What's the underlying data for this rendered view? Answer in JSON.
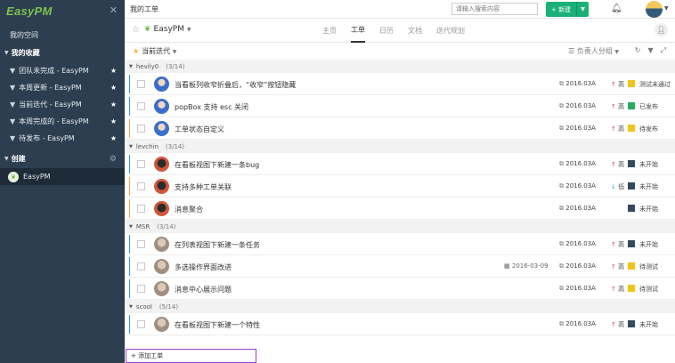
{
  "sidebar": {
    "logo": "EasyPM",
    "my_space": "我的空间",
    "favorites_header": "我的收藏",
    "favorites": [
      "团队未完成 - EasyPM",
      "本周更新 - EasyPM",
      "当前迭代 - EasyPM",
      "本周完成的 - EasyPM",
      "待发布 - EasyPM"
    ],
    "created_header": "创建",
    "project": "EasyPM"
  },
  "topbar": {
    "title": "我的工单",
    "search_placeholder": "请输入搜索内容",
    "new_button": "+ 新建"
  },
  "project": {
    "name": "EasyPM",
    "tabs": [
      "主页",
      "工单",
      "日历",
      "文档",
      "迭代规划"
    ],
    "active_tab": "工单"
  },
  "filter": {
    "iteration": "当前迭代",
    "group_by": "负责人分组"
  },
  "colors": {
    "accent": "#1ab07a",
    "sidebar": "#2c3e50",
    "status_testing": "#f0c419",
    "status_released": "#27ae60",
    "status_pending": "#f0c419",
    "status_notstarted": "#34495e"
  },
  "groups": [
    {
      "name": "hevily0",
      "count": "(3/14)",
      "items": [
        {
          "title": "当看板列收窄折叠后，“收窄”按钮隐藏",
          "date": "",
          "version": "2016.03A",
          "priority": "高",
          "priority_dir": "up",
          "status": "测试未通过",
          "status_color": "#f0c419",
          "avatar": "blue",
          "bar": "blue"
        },
        {
          "title": "popBox 支持 esc 关闭",
          "date": "",
          "version": "2016.03A",
          "priority": "高",
          "priority_dir": "up",
          "status": "已发布",
          "status_color": "#27ae60",
          "avatar": "blue",
          "bar": "blue"
        },
        {
          "title": "工单状态自定义",
          "date": "",
          "version": "2016.03A",
          "priority": "高",
          "priority_dir": "up",
          "status": "待发布",
          "status_color": "#f0c419",
          "avatar": "blue",
          "bar": "orange"
        }
      ]
    },
    {
      "name": "levchin",
      "count": "(3/14)",
      "items": [
        {
          "title": "在看板视图下新建一条bug",
          "date": "",
          "version": "2016.03A",
          "priority": "高",
          "priority_dir": "up",
          "status": "未开始",
          "status_color": "#34495e",
          "avatar": "dark",
          "bar": "blue"
        },
        {
          "title": "支持多种工单关联",
          "date": "",
          "version": "2016.03A",
          "priority": "低",
          "priority_dir": "down",
          "status": "未开始",
          "status_color": "#34495e",
          "avatar": "dark",
          "bar": "orange"
        },
        {
          "title": "消息聚合",
          "date": "",
          "version": "2016.03A",
          "priority": "",
          "priority_dir": "",
          "status": "未开始",
          "status_color": "#34495e",
          "avatar": "dark",
          "bar": "orange"
        }
      ]
    },
    {
      "name": "MSR",
      "count": "(3/14)",
      "items": [
        {
          "title": "在列表视图下新建一条任务",
          "date": "",
          "version": "2016.03A",
          "priority": "高",
          "priority_dir": "up",
          "status": "未开始",
          "status_color": "#34495e",
          "avatar": "light",
          "bar": "blue"
        },
        {
          "title": "多选操作界面改进",
          "date": "2016-03-09",
          "version": "2016.03A",
          "priority": "高",
          "priority_dir": "up",
          "status": "待测试",
          "status_color": "#f0c419",
          "avatar": "light",
          "bar": "blue"
        },
        {
          "title": "消息中心展示问题",
          "date": "",
          "version": "2016.03A",
          "priority": "高",
          "priority_dir": "up",
          "status": "待测试",
          "status_color": "#f0c419",
          "avatar": "light",
          "bar": "blue"
        }
      ]
    },
    {
      "name": "scool",
      "count": "(5/14)",
      "items": [
        {
          "title": "在看板视图下新建一个特性",
          "date": "",
          "version": "2016.03A",
          "priority": "高",
          "priority_dir": "up",
          "status": "未开始",
          "status_color": "#34495e",
          "avatar": "light",
          "bar": "blue"
        }
      ]
    }
  ],
  "add_ticket": "+ 添加工单"
}
